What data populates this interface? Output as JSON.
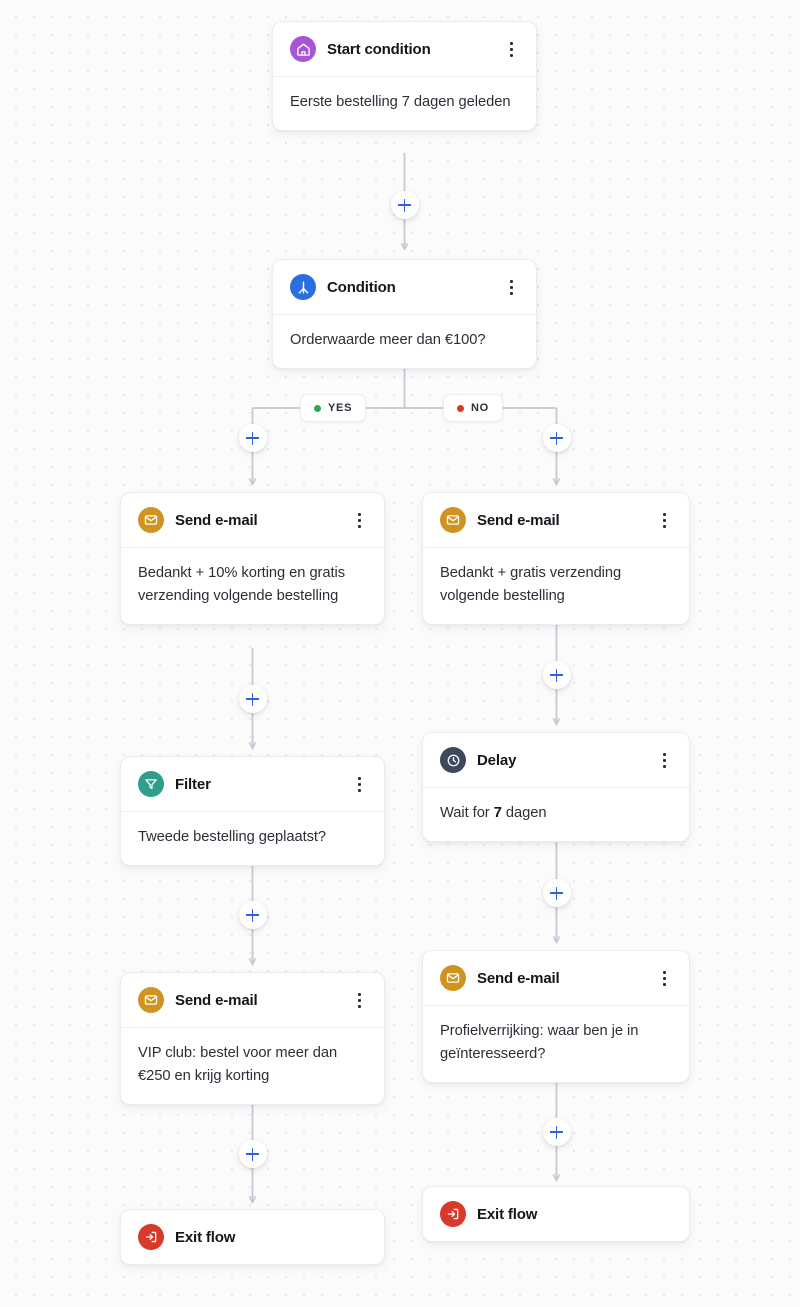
{
  "canvas": {
    "background_color": "#fbfbfc",
    "dot_color": "#e7e7ec",
    "connector_color": "#c3c8d0",
    "plus_color": "#2f5fe0"
  },
  "icon_colors": {
    "start": "#a855d4",
    "condition": "#2b6ee0",
    "email": "#cf9420",
    "filter": "#2f9e8a",
    "delay": "#3e4a5c",
    "exit": "#d73a2b"
  },
  "nodes": {
    "start_condition": {
      "title": "Start condition",
      "icon": "home-icon",
      "body": "Eerste bestelling 7 dagen geleden"
    },
    "condition": {
      "title": "Condition",
      "icon": "branch-icon",
      "body": "Orderwaarde meer dan €100?"
    },
    "email_yes": {
      "title": "Send e-mail",
      "icon": "envelope-icon",
      "body": "Bedankt + 10% korting en gratis verzending volgende bestelling"
    },
    "email_no": {
      "title": "Send e-mail",
      "icon": "envelope-icon",
      "body": "Bedankt + gratis verzending volgende bestelling"
    },
    "filter": {
      "title": "Filter",
      "icon": "funnel-icon",
      "body": "Tweede bestelling geplaatst?"
    },
    "delay": {
      "title": "Delay",
      "icon": "clock-icon",
      "body_prefix": "Wait for ",
      "body_value": "7",
      "body_suffix": " dagen"
    },
    "email_vip": {
      "title": "Send e-mail",
      "icon": "envelope-icon",
      "body": "VIP club: bestel voor meer dan €250 en krijg korting"
    },
    "email_profile": {
      "title": "Send e-mail",
      "icon": "envelope-icon",
      "body": "Profielverrijking: waar ben je in geïnteresseerd?"
    },
    "exit_left": {
      "title": "Exit flow",
      "icon": "exit-icon"
    },
    "exit_right": {
      "title": "Exit flow",
      "icon": "exit-icon"
    }
  },
  "branches": {
    "yes": {
      "label": "YES",
      "dot_color": "#2ea84f"
    },
    "no": {
      "label": "NO",
      "dot_color": "#d73a2b"
    }
  },
  "add_buttons": {
    "after_start": "+",
    "yes_branch": "+",
    "no_branch": "+",
    "after_email_yes": "+",
    "after_email_no": "+",
    "after_filter": "+",
    "after_delay": "+",
    "after_email_vip": "+",
    "after_email_profile": "+"
  }
}
